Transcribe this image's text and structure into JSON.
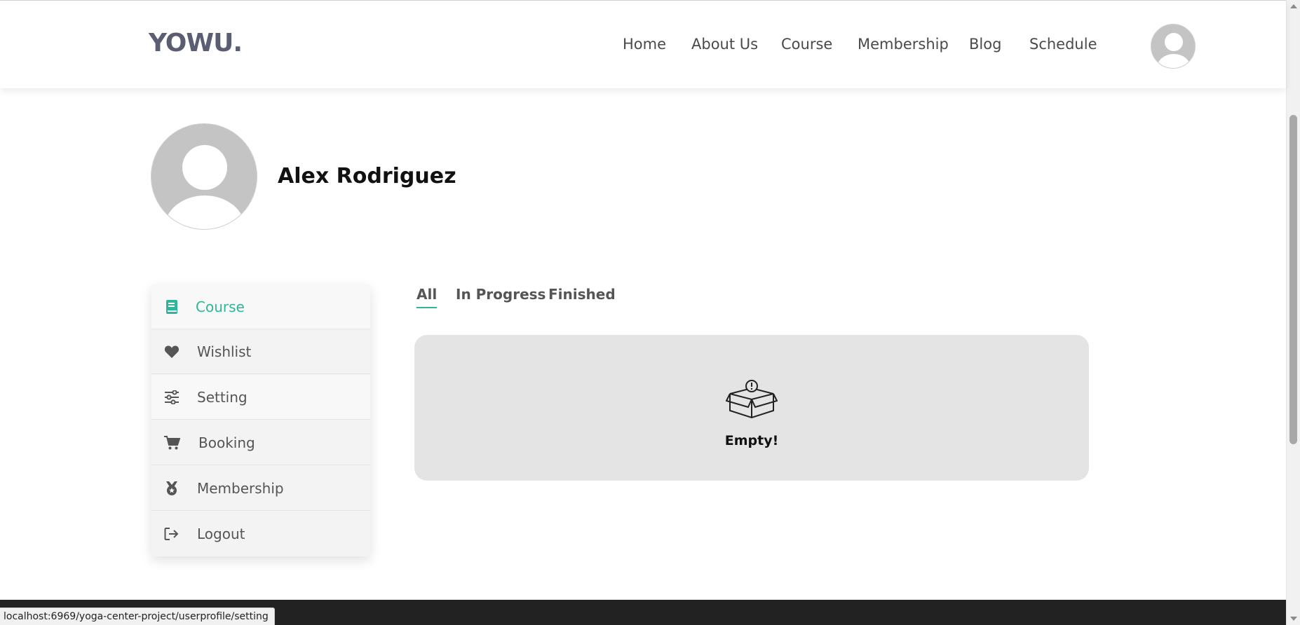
{
  "header": {
    "logo": "YOWU.",
    "nav": [
      {
        "label": "Home"
      },
      {
        "label": "About Us"
      },
      {
        "label": "Course"
      },
      {
        "label": "Membership"
      },
      {
        "label": "Blog"
      },
      {
        "label": "Schedule"
      }
    ],
    "avatar_icon": "user-avatar-icon"
  },
  "profile": {
    "name": "Alex Rodriguez",
    "avatar_icon": "user-avatar-icon"
  },
  "sidebar": {
    "items": [
      {
        "label": "Course",
        "icon": "book-icon",
        "active": true
      },
      {
        "label": "Wishlist",
        "icon": "heart-icon",
        "active": false
      },
      {
        "label": "Setting",
        "icon": "sliders-icon",
        "active": false
      },
      {
        "label": "Booking",
        "icon": "cart-icon",
        "active": false
      },
      {
        "label": "Membership",
        "icon": "medal-icon",
        "active": false
      },
      {
        "label": "Logout",
        "icon": "logout-icon",
        "active": false
      }
    ]
  },
  "tabs": [
    {
      "label": "All",
      "active": true
    },
    {
      "label": "In Progress",
      "active": false
    },
    {
      "label": "Finished",
      "active": false
    }
  ],
  "content": {
    "empty_text": "Empty!",
    "empty_icon": "empty-box-icon"
  },
  "status_bar": {
    "url": "localhost:6969/yoga-center-project/userprofile/setting"
  },
  "colors": {
    "accent": "#2fb59b",
    "logo": "#5b5d73",
    "footer": "#222222",
    "panel": "#e4e4e4"
  }
}
